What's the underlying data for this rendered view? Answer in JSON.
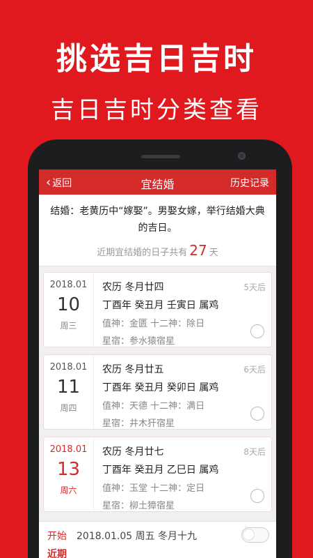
{
  "promo": {
    "headline": "挑选吉日吉时",
    "subline": "吉日吉时分类查看"
  },
  "navbar": {
    "back_label": "返回",
    "title": "宜结婚",
    "history_label": "历史记录"
  },
  "intro": {
    "description": "结婚：老黄历中“嫁娶”。男娶女嫁，举行结婚大典的吉日。",
    "count_prefix": "近期宜结婚的日子共有",
    "count_value": "27",
    "count_suffix": "天"
  },
  "days": [
    {
      "year_month": "2018.01",
      "day": "10",
      "weekday": "周三",
      "lunar": "农历  冬月廿四",
      "ganzhi": "丁酉年 癸丑月 壬寅日 属鸡",
      "zhishen": "值神：金匮  十二神：除日",
      "xingxiu": "星宿：参水猿宿星",
      "days_later": "5天后"
    },
    {
      "year_month": "2018.01",
      "day": "11",
      "weekday": "周四",
      "lunar": "农历  冬月廿五",
      "ganzhi": "丁酉年 癸丑月 癸卯日 属鸡",
      "zhishen": "值神：天德  十二神：满日",
      "xingxiu": "星宿：井木犴宿星",
      "days_later": "6天后"
    },
    {
      "year_month": "2018.01",
      "day": "13",
      "weekday": "周六",
      "lunar": "农历  冬月廿七",
      "ganzhi": "丁酉年 癸丑月 乙巳日 属鸡",
      "zhishen": "值神：玉堂  十二神：定日",
      "xingxiu": "星宿：柳土獐宿星",
      "days_later": "8天后"
    }
  ],
  "footer": {
    "start_label": "开始",
    "start_value": "2018.01.05 周五 冬月十九",
    "end_label": "近期"
  },
  "colors": {
    "brand_red": "#e0191e",
    "nav_red": "#d52a2a"
  }
}
